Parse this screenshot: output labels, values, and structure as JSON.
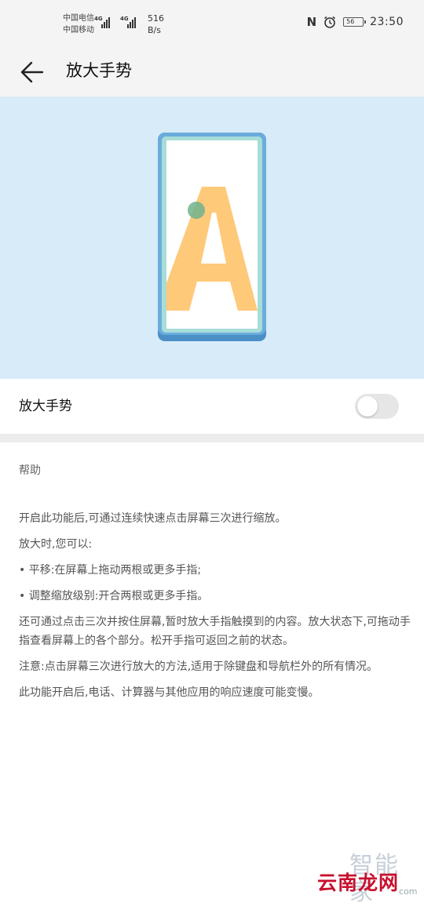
{
  "status_bar": {
    "carrier_1": "中国电信",
    "carrier_2": "中国移动",
    "network_1": "4G",
    "network_2": "4G",
    "speed_value": "516",
    "speed_unit": "B/s",
    "battery_level": "56",
    "time": "23:50"
  },
  "header": {
    "title": "放大手势"
  },
  "setting": {
    "label": "放大手势",
    "enabled": false
  },
  "help": {
    "title": "帮助",
    "paragraphs": [
      "开启此功能后,可通过连续快速点击屏幕三次进行缩放。",
      "放大时,您可以:",
      "• 平移:在屏幕上拖动两根或更多手指;",
      "• 调整缩放级别:开合两根或更多手指。",
      "还可通过点击三次并按住屏幕,暂时放大手指触摸到的内容。放大状态下,可拖动手指查看屏幕上的各个部分。松开手指可返回之前的状态。",
      "注意:点击屏幕三次进行放大的方法,适用于除键盘和导航栏外的所有情况。",
      "此功能开启后,电话、计算器与其他应用的响应速度可能变慢。"
    ]
  },
  "watermark": {
    "line1": "智能家",
    "line2": "云南龙网",
    "line3": "com"
  },
  "illustration": {
    "letter": "A",
    "colors": {
      "background": "#d8ebf8",
      "phone_frame": "#5b9fd1",
      "letter": "#ffc97a",
      "touch_dot": "#6fb38d"
    }
  }
}
